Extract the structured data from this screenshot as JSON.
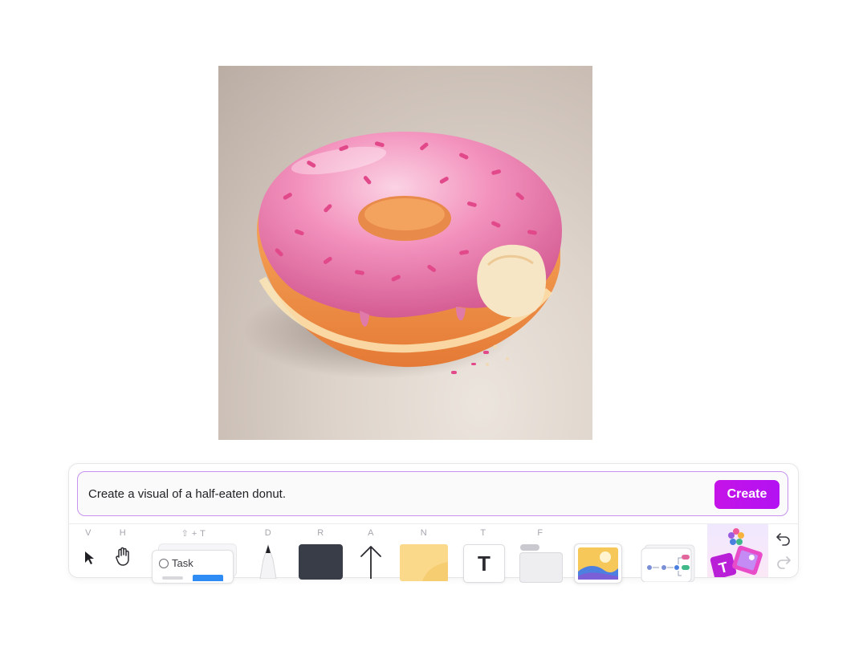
{
  "prompt": {
    "value": "Create a visual of a half-eaten donut.",
    "create_label": "Create"
  },
  "toolbar": {
    "tools": [
      {
        "key": "V",
        "name": "select"
      },
      {
        "key": "H",
        "name": "hand"
      },
      {
        "key": "⇧ + T",
        "name": "task"
      },
      {
        "key": "D",
        "name": "draw"
      },
      {
        "key": "R",
        "name": "rectangle"
      },
      {
        "key": "A",
        "name": "arrow"
      },
      {
        "key": "N",
        "name": "sticky-note"
      },
      {
        "key": "T",
        "name": "text"
      },
      {
        "key": "F",
        "name": "frame"
      }
    ],
    "task_label": "Task",
    "text_tool_glyph": "T"
  },
  "colors": {
    "create_button": "#c513e8",
    "prompt_border": "#c792f0",
    "rectangle": "#383d47",
    "sticky": "#fbd98a",
    "donut_frosting": "#f07fb0"
  }
}
